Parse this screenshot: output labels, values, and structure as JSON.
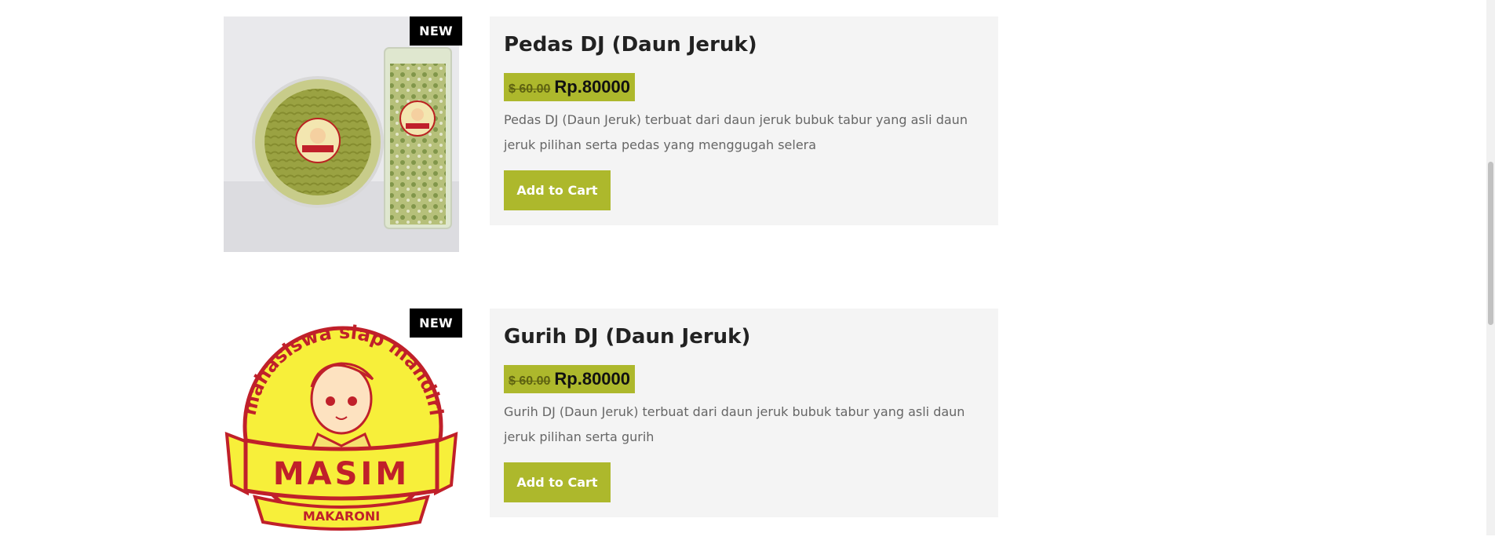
{
  "products": [
    {
      "badge": "NEW",
      "title": "Pedas DJ (Daun Jeruk)",
      "old_price": "$ 60.00",
      "price": "Rp.80000",
      "description": "Pedas DJ (Daun Jeruk) terbuat dari daun jeruk bubuk tabur yang asli daun jeruk pilihan serta pedas yang menggugah selera",
      "button_label": "Add to Cart"
    },
    {
      "badge": "NEW",
      "title": "Gurih DJ (Daun Jeruk)",
      "old_price": "$ 60.00",
      "price": "Rp.80000",
      "description": "Gurih DJ (Daun Jeruk) terbuat dari daun jeruk bubuk tabur yang asli daun jeruk pilihan serta gurih",
      "button_label": "Add to Cart"
    }
  ],
  "logo": {
    "arc_text": "mahasiswa siap mandiri",
    "brand": "MASIM",
    "subtitle": "MAKARONI"
  },
  "colors": {
    "accent": "#adb82c",
    "badge_bg": "#000000",
    "card_bg": "#f4f4f4",
    "logo_yellow": "#f7ef3a",
    "logo_red": "#c0202a"
  }
}
